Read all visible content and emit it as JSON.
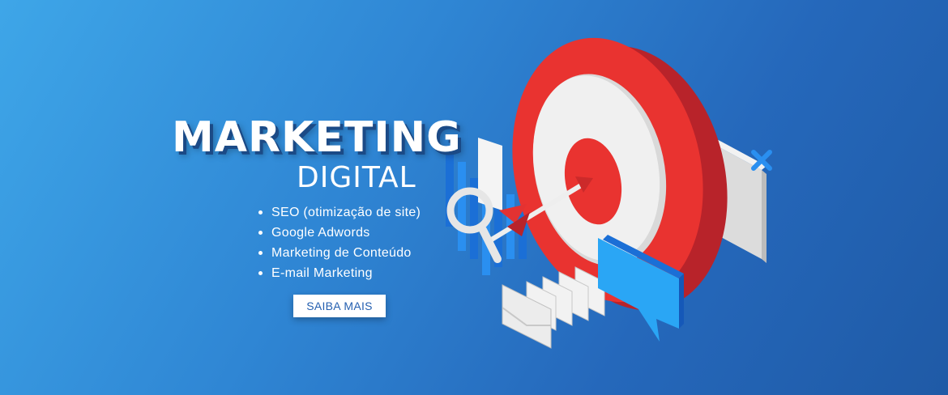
{
  "hero": {
    "title": "MARKETING",
    "subtitle": "DIGITAL",
    "services": [
      "SEO (otimização de site)",
      "Google Adwords",
      "Marketing de Conteúdo",
      "E-mail Marketing"
    ],
    "cta_label": "SAIBA MAIS"
  },
  "colors": {
    "background_start": "#3ea6e8",
    "background_end": "#1f5aa6",
    "target_red": "#e93330",
    "target_white": "#eeeeee",
    "accent_blue": "#2aa6f5"
  },
  "icons": [
    "bullseye-target-icon",
    "arrow-icon",
    "magnifying-glass-icon",
    "bar-chart-icon",
    "envelope-icon",
    "chat-bubble-icon",
    "cross-icon"
  ]
}
